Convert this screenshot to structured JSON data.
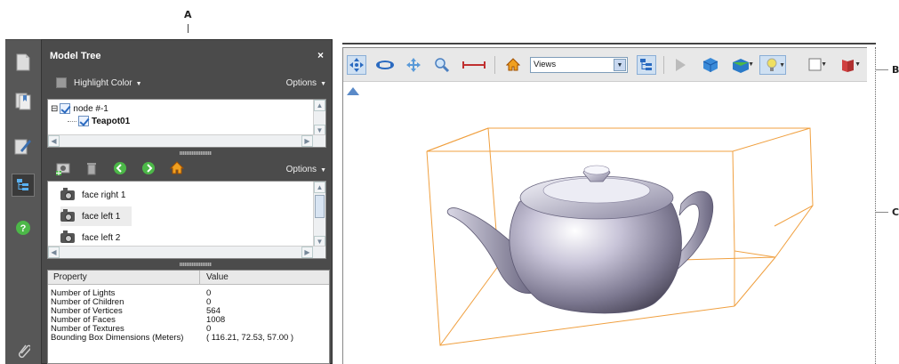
{
  "callouts": {
    "a": "A",
    "b": "B",
    "c": "C"
  },
  "panel": {
    "title": "Model Tree",
    "close": "×",
    "highlight_label": "Highlight Color",
    "options_label": "Options",
    "tree": [
      {
        "label": "node #-1",
        "expander": "⊟"
      },
      {
        "label": "Teapot01"
      }
    ],
    "views": [
      "face right 1",
      "face left 1",
      "face left 2"
    ],
    "properties": {
      "headers": [
        "Property",
        "Value"
      ],
      "rows": [
        [
          "Number of Lights",
          "0"
        ],
        [
          "Number of Children",
          "0"
        ],
        [
          "Number of Vertices",
          "564"
        ],
        [
          "Number of Faces",
          "1008"
        ],
        [
          "Number of Textures",
          "0"
        ],
        [
          "Bounding Box Dimensions (Meters)",
          "( 116.21, 72.53, 57.00 )"
        ]
      ]
    }
  },
  "viewer": {
    "views_select": "Views",
    "toolbar_icons": [
      "rotate-icon",
      "spin-icon",
      "pan-icon",
      "zoom-icon",
      "measure-icon",
      "home-icon",
      "model-tree-icon",
      "play-icon",
      "projection-icon",
      "render-mode-icon",
      "lighting-icon",
      "background-color-icon",
      "cross-section-icon"
    ]
  },
  "colors": {
    "panel_bg": "#4b4b4b",
    "rail_bg": "#575757",
    "bbox_color": "#f0a040",
    "toolbar_bg": "#e8e8e8"
  }
}
